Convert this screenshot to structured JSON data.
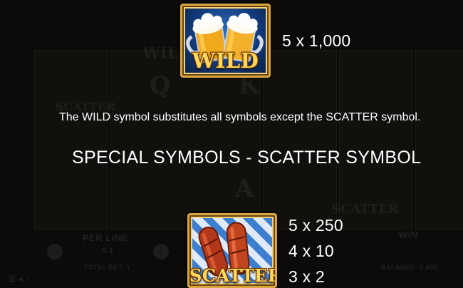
{
  "wild": {
    "icon": "wild-beer-mugs-icon",
    "label": "WILD",
    "payout": "5 x 1,000",
    "description": "The WILD symbol substitutes all symbols except the SCATTER symbol."
  },
  "scatter_section": {
    "title": "SPECIAL SYMBOLS - SCATTER SYMBOL",
    "icon": "scatter-sausages-icon",
    "label": "SCATTER",
    "payouts": [
      "5 x 250",
      "4 x 10",
      "3 x 2"
    ]
  },
  "background": {
    "symbols": [
      "WILD",
      "SCATTER",
      "SCATTER",
      "Q",
      "K",
      "A"
    ],
    "per_line_label": "PER LINE",
    "bet_value": "0.1",
    "total_bet": "TOTAL BET: 1",
    "win_label": "WIN",
    "balance": "BALANCE: 5,000",
    "minus": "−",
    "plus": "+",
    "menu_glyph": "☰ ◂ ♪"
  },
  "colors": {
    "background": "#0c0b09",
    "gold_frame": "#d9a640",
    "label_gold": "#ffd75a",
    "wild_blue": "#2f6fc0",
    "text": "#ffffff"
  }
}
